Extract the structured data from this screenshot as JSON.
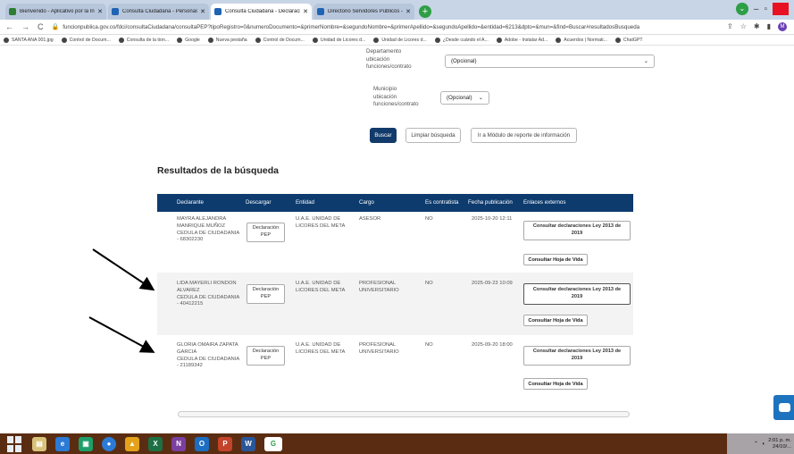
{
  "browser": {
    "tabs": [
      {
        "label": "Bienvenido - Aplicativo por la Ini",
        "active": false
      },
      {
        "label": "Consulta Ciudadana - Personas !",
        "active": false
      },
      {
        "label": "Consulta Ciudadana - Declaracio",
        "active": true
      },
      {
        "label": "Directorio Servidores Públicos -",
        "active": false
      }
    ],
    "new_tab": "+",
    "url": "funcionpublica.gov.co/fdci/consultaCiudadana/consultaPEP?tipoRegistro=0&numeroDocumento=&primerNombre=&segundoNombre=&primerApellido=&segundoApellido=&entidad=6213&dpto=&mun=&find=Buscar#resultadosBusqueda",
    "profile_initial": "M",
    "bookmarks": [
      "SANTA ANA 001.jpg",
      "Control de Docum...",
      "Consulta de la tion...",
      "Google",
      "Nueva pestaña",
      "Control de Docum...",
      "Unidad de Licores d...",
      "Unidad de Licores d...",
      "¿Desde cuándo el A...",
      "Adobe - Instalar Ad...",
      "Acuerdos | Normati...",
      "ChatGPT"
    ]
  },
  "form": {
    "dept_label": [
      "Departamento",
      "ubicación",
      "funciones/contrato"
    ],
    "dept_value": "(Opcional)",
    "mun_label": [
      "Municipio",
      "ubicación",
      "funciones/contrato"
    ],
    "mun_value": "(Opcional)",
    "search_button": "Buscar",
    "clear_button": "Limpiar búsqueda",
    "report_button": "Ir a Módulo de reporte de información"
  },
  "results": {
    "title": "Resultados de la búsqueda",
    "columns": [
      "Declarante",
      "Descargar",
      "Entidad",
      "Cargo",
      "Es contratista",
      "Fecha publicación",
      "Enlaces externos"
    ],
    "rows": [
      {
        "name": [
          "MAYRA ALEJANDRA",
          "MANRIQUE MUÑOZ"
        ],
        "doc": [
          "CEDULA DE CIUDADANIA",
          "- 68302230"
        ],
        "download": [
          "Declaración",
          "PEP"
        ],
        "entity": [
          "U.A.E. UNIDAD DE",
          "LICORES DEL META"
        ],
        "position": [
          "ASESOR"
        ],
        "contractor": "NO",
        "date": "2025-10-20 12:11",
        "link_law": [
          "Consultar declaraciones Ley 2013 de",
          "2019"
        ],
        "link_cv": "Consultar Hoja de Vida"
      },
      {
        "name": [
          "LIDA MAYERLI RONDON",
          "ALVAREZ"
        ],
        "doc": [
          "CEDULA DE CIUDADANIA",
          "- 40412215"
        ],
        "download": [
          "Declaración",
          "PEP"
        ],
        "entity": [
          "U.A.E. UNIDAD DE",
          "LICORES DEL META"
        ],
        "position": [
          "PROFESIONAL",
          "UNIVERSITARIO"
        ],
        "contractor": "NO",
        "date": "2025-09-23 10:09",
        "link_law": [
          "Consultar declaraciones Ley 2013 de",
          "2019"
        ],
        "link_cv": "Consultar Hoja de Vida"
      },
      {
        "name": [
          "GLORIA OMAIRA ZAPATA",
          "GARCIA"
        ],
        "doc": [
          "CEDULA DE CIUDADANIA",
          "- 21189342"
        ],
        "download": [
          "Declaración",
          "PEP"
        ],
        "entity": [
          "U.A.E. UNIDAD DE",
          "LICORES DEL META"
        ],
        "position": [
          "PROFESIONAL",
          "UNIVERSITARIO"
        ],
        "contractor": "NO",
        "date": "2025-09-20 18:00",
        "link_law": [
          "Consultar declaraciones Ley 2013 de",
          "2019"
        ],
        "link_cv": "Consultar Hoja de Vida"
      }
    ]
  },
  "taskbar": {
    "clock": [
      "2:01 p. m.",
      "24/10/..."
    ]
  },
  "colors": {
    "header_bg": "#0d3b6e",
    "primary_button": "#123b6b",
    "tabbar": "#c8d5e6",
    "taskbar": "#5a2d12"
  }
}
